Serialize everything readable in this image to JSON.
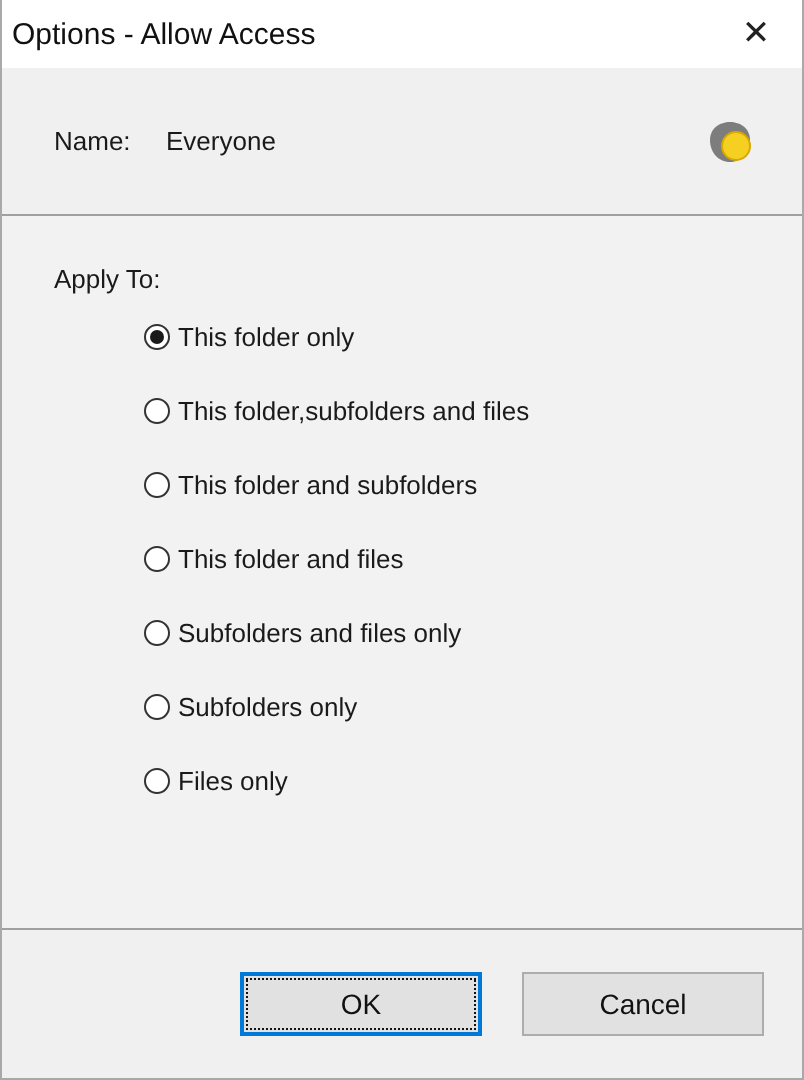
{
  "window": {
    "title": "Options - Allow Access",
    "close": "✕"
  },
  "principal": {
    "label": "Name:",
    "value": "Everyone"
  },
  "apply_to": {
    "label": "Apply To:",
    "options": [
      {
        "label": "This folder only",
        "selected": true
      },
      {
        "label": "This folder,subfolders and files",
        "selected": false
      },
      {
        "label": "This folder and subfolders",
        "selected": false
      },
      {
        "label": "This folder and files",
        "selected": false
      },
      {
        "label": "Subfolders and files only",
        "selected": false
      },
      {
        "label": "Subfolders only",
        "selected": false
      },
      {
        "label": "Files only",
        "selected": false
      }
    ]
  },
  "buttons": [
    {
      "label": "OK",
      "default": true
    },
    {
      "label": "Cancel",
      "default": false
    }
  ]
}
